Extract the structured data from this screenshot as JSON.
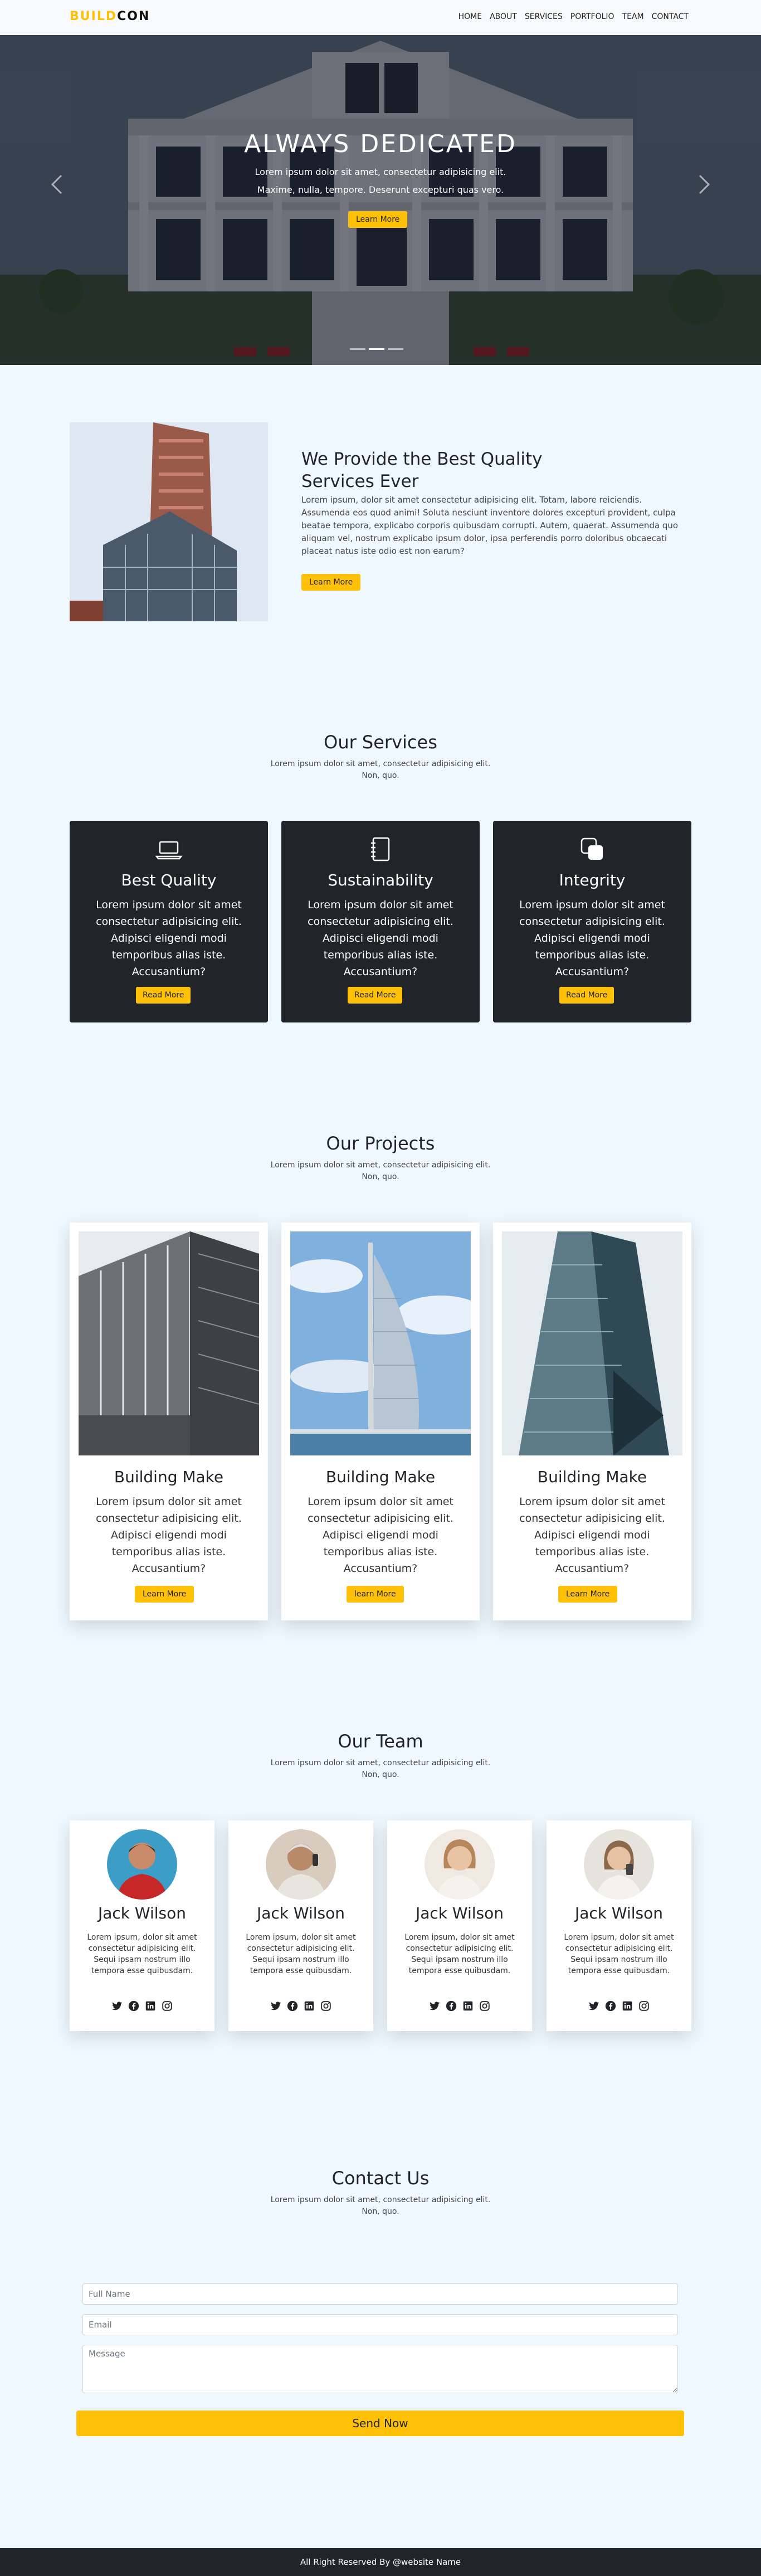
{
  "navbar": {
    "brand_part1": "BUILD",
    "brand_part2": "CON",
    "links": [
      "HOME",
      "ABOUT",
      "SERVICES",
      "PORTFOLIO",
      "TEAM",
      "CONTACT"
    ]
  },
  "hero": {
    "title": "ALWAYS DEDICATED",
    "line1": "Lorem ipsum dolor sit amet, consectetur adipisicing elit.",
    "line2": "Maxime, nulla, tempore. Deserunt excepturi quas vero.",
    "button": "Learn More",
    "prev_icon": "chevron-left",
    "next_icon": "chevron-right",
    "slide_count": 3,
    "active_slide": 2
  },
  "about": {
    "title": "We Provide the Best Quality Services Ever",
    "text": "Lorem ipsum, dolor sit amet consectetur adipisicing elit. Totam, labore reiciendis. Assumenda eos quod animi! Soluta nesciunt inventore dolores excepturi provident, culpa beatae tempora, explicabo corporis quibusdam corrupti. Autem, quaerat. Assumenda quo aliquam vel, nostrum explicabo ipsum dolor, ipsa perferendis porro doloribus obcaecati placeat natus iste odio est non earum?",
    "button": "Learn More"
  },
  "services": {
    "title": "Our Services",
    "subtitle": "Lorem ipsum dolor sit amet, consectetur adipisicing elit. Non, quo.",
    "items": [
      {
        "icon": "laptop-icon",
        "title": "Best Quality",
        "text": "Lorem ipsum dolor sit amet consectetur adipisicing elit. Adipisci eligendi modi temporibus alias iste. Accusantium?",
        "button": "Read More"
      },
      {
        "icon": "journal-icon",
        "title": "Sustainability",
        "text": "Lorem ipsum dolor sit amet consectetur adipisicing elit. Adipisci eligendi modi temporibus alias iste. Accusantium?",
        "button": "Read More"
      },
      {
        "icon": "layers-icon",
        "title": "Integrity",
        "text": "Lorem ipsum dolor sit amet consectetur adipisicing elit. Adipisci eligendi modi temporibus alias iste. Accusantium?",
        "button": "Read More"
      }
    ]
  },
  "projects": {
    "title": "Our Projects",
    "subtitle": "Lorem ipsum dolor sit amet, consectetur adipisicing elit. Non, quo.",
    "items": [
      {
        "title": "Building Make",
        "text": "Lorem ipsum dolor sit amet consectetur adipisicing elit. Adipisci eligendi modi temporibus alias iste. Accusantium?",
        "button": "Learn More"
      },
      {
        "title": "Building Make",
        "text": "Lorem ipsum dolor sit amet consectetur adipisicing elit. Adipisci eligendi modi temporibus alias iste. Accusantium?",
        "button": "learn More"
      },
      {
        "title": "Building Make",
        "text": "Lorem ipsum dolor sit amet consectetur adipisicing elit. Adipisci eligendi modi temporibus alias iste. Accusantium?",
        "button": "Learn More"
      }
    ]
  },
  "team": {
    "title": "Our Team",
    "subtitle": "Lorem ipsum dolor sit amet, consectetur adipisicing elit. Non, quo.",
    "members": [
      {
        "name": "Jack Wilson",
        "bio": "Lorem ipsum, dolor sit amet consectetur adipisicing elit. Sequi ipsam nostrum illo tempora esse quibusdam."
      },
      {
        "name": "Jack Wilson",
        "bio": "Lorem ipsum, dolor sit amet consectetur adipisicing elit. Sequi ipsam nostrum illo tempora esse quibusdam."
      },
      {
        "name": "Jack Wilson",
        "bio": "Lorem ipsum, dolor sit amet consectetur adipisicing elit. Sequi ipsam nostrum illo tempora esse quibusdam."
      },
      {
        "name": "Jack Wilson",
        "bio": "Lorem ipsum, dolor sit amet consectetur adipisicing elit. Sequi ipsam nostrum illo tempora esse quibusdam."
      }
    ],
    "social_icons": [
      "twitter-icon",
      "facebook-icon",
      "linkedin-icon",
      "instagram-icon"
    ]
  },
  "contact": {
    "title": "Contact Us",
    "subtitle": "Lorem ipsum dolor sit amet, consectetur adipisicing elit. Non, quo.",
    "name_placeholder": "Full Name",
    "email_placeholder": "Email",
    "message_placeholder": "Message",
    "button": "Send Now"
  },
  "footer": {
    "text": "All Right Reserved By @website Name"
  },
  "colors": {
    "accent": "#ffc107",
    "dark": "#212529",
    "page_bg": "#f0f8ff"
  }
}
